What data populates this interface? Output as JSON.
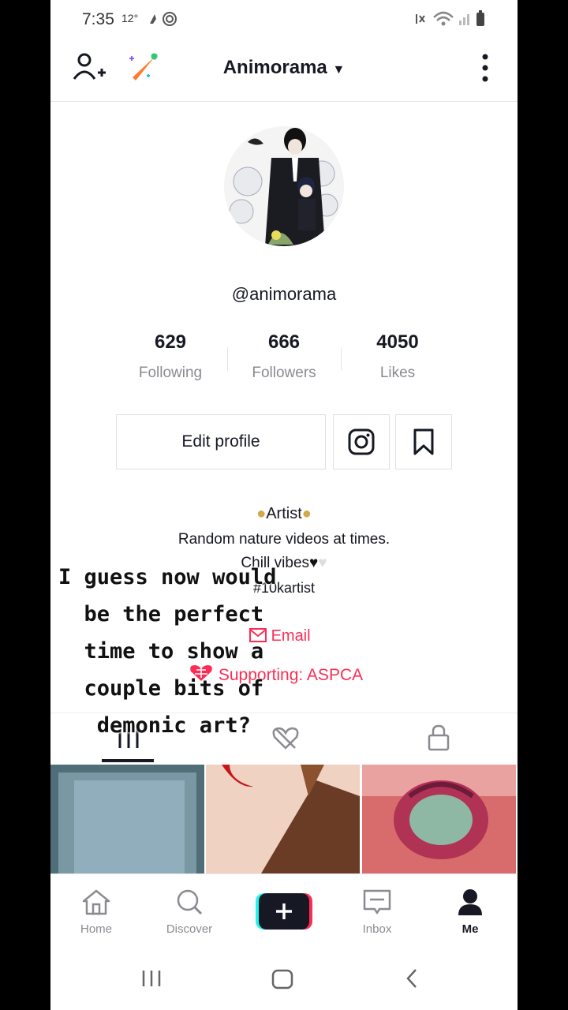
{
  "status_bar": {
    "time": "7:35",
    "temperature": "12°"
  },
  "header": {
    "title": "Animorama",
    "dropdown_icon": "caret-down-icon"
  },
  "profile": {
    "handle": "@animorama",
    "stats": [
      {
        "value": "629",
        "label": "Following"
      },
      {
        "value": "666",
        "label": "Followers"
      },
      {
        "value": "4050",
        "label": "Likes"
      }
    ],
    "edit_label": "Edit profile",
    "bio": {
      "line1": "Artist",
      "line2": "Random nature videos at times.",
      "line3": "Chill vibes",
      "line4": "#10kartist"
    },
    "email_label": "Email",
    "support_label": "Supporting: ASPCA"
  },
  "caption": "I guess now would\n  be the perfect\n  time to show a\n  couple bits of\n   demonic art?",
  "tabs": [
    "videos",
    "liked",
    "private"
  ],
  "bottom_nav": [
    {
      "label": "Home"
    },
    {
      "label": "Discover"
    },
    {
      "label": ""
    },
    {
      "label": "Inbox"
    },
    {
      "label": "Me"
    }
  ],
  "colors": {
    "accent": "#fe2c55",
    "text": "#161823",
    "muted": "#8a8b91"
  }
}
